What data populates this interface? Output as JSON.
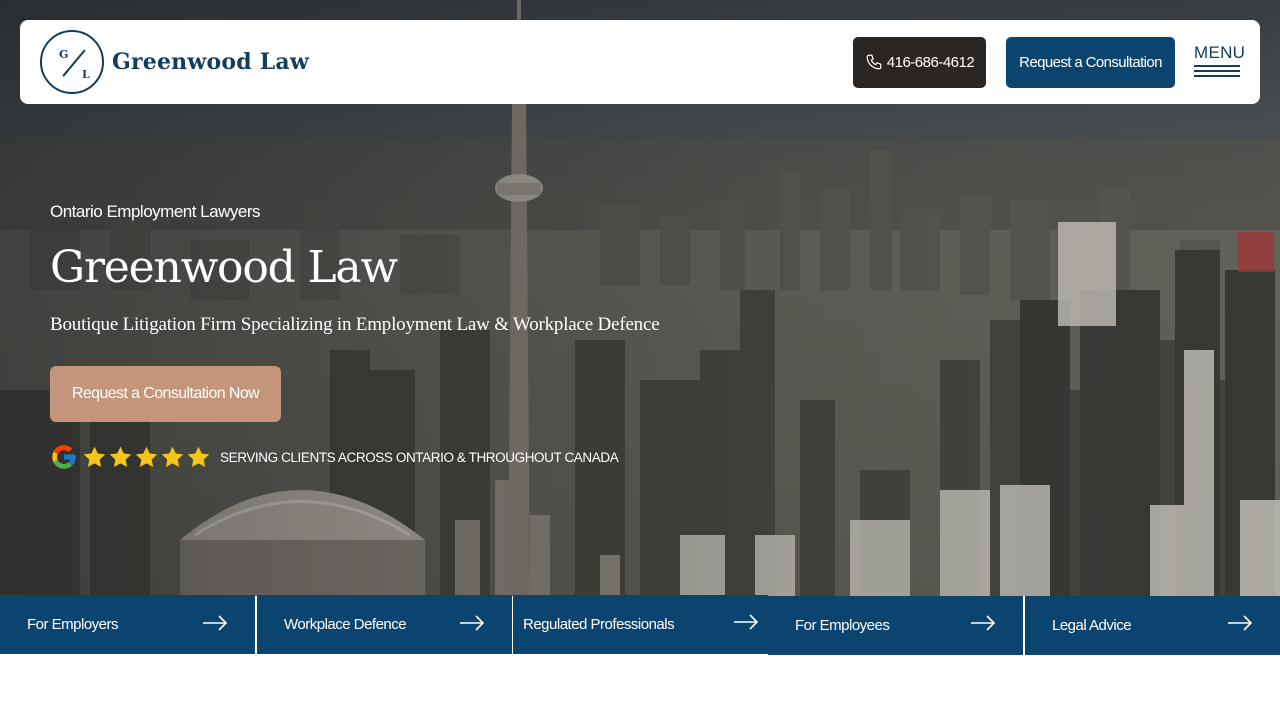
{
  "brand": {
    "logo_initial_top": "G",
    "logo_initial_bottom": "L",
    "name": "Greenwood Law",
    "primary_color": "#0c4470",
    "accent_color": "#c4957a"
  },
  "header": {
    "phone_label": "416-686-4612",
    "phone_icon": "phone-icon",
    "consult_label": "Request a Consultation",
    "menu_label": "MENU",
    "menu_icon": "hamburger-icon"
  },
  "hero": {
    "eyebrow": "Ontario Employment Lawyers",
    "title": "Greenwood Law",
    "subtitle": "Boutique Litigation Firm Specializing in Employment Law & Workplace Defence",
    "cta_label": "Request a Consultation Now",
    "rating": {
      "icon": "google-icon",
      "stars": 5,
      "max_stars": 5
    },
    "serving_text": "SERVING CLIENTS ACROSS ONTARIO & THROUGHOUT CANADA"
  },
  "tabs": [
    {
      "label": "For Employers",
      "icon": "arrow-right-icon"
    },
    {
      "label": "Workplace Defence",
      "icon": "arrow-right-icon"
    },
    {
      "label": "Regulated Professionals",
      "icon": "arrow-right-icon"
    },
    {
      "label": "For Employees",
      "icon": "arrow-right-icon"
    },
    {
      "label": "Legal Advice",
      "icon": "arrow-right-icon"
    }
  ]
}
